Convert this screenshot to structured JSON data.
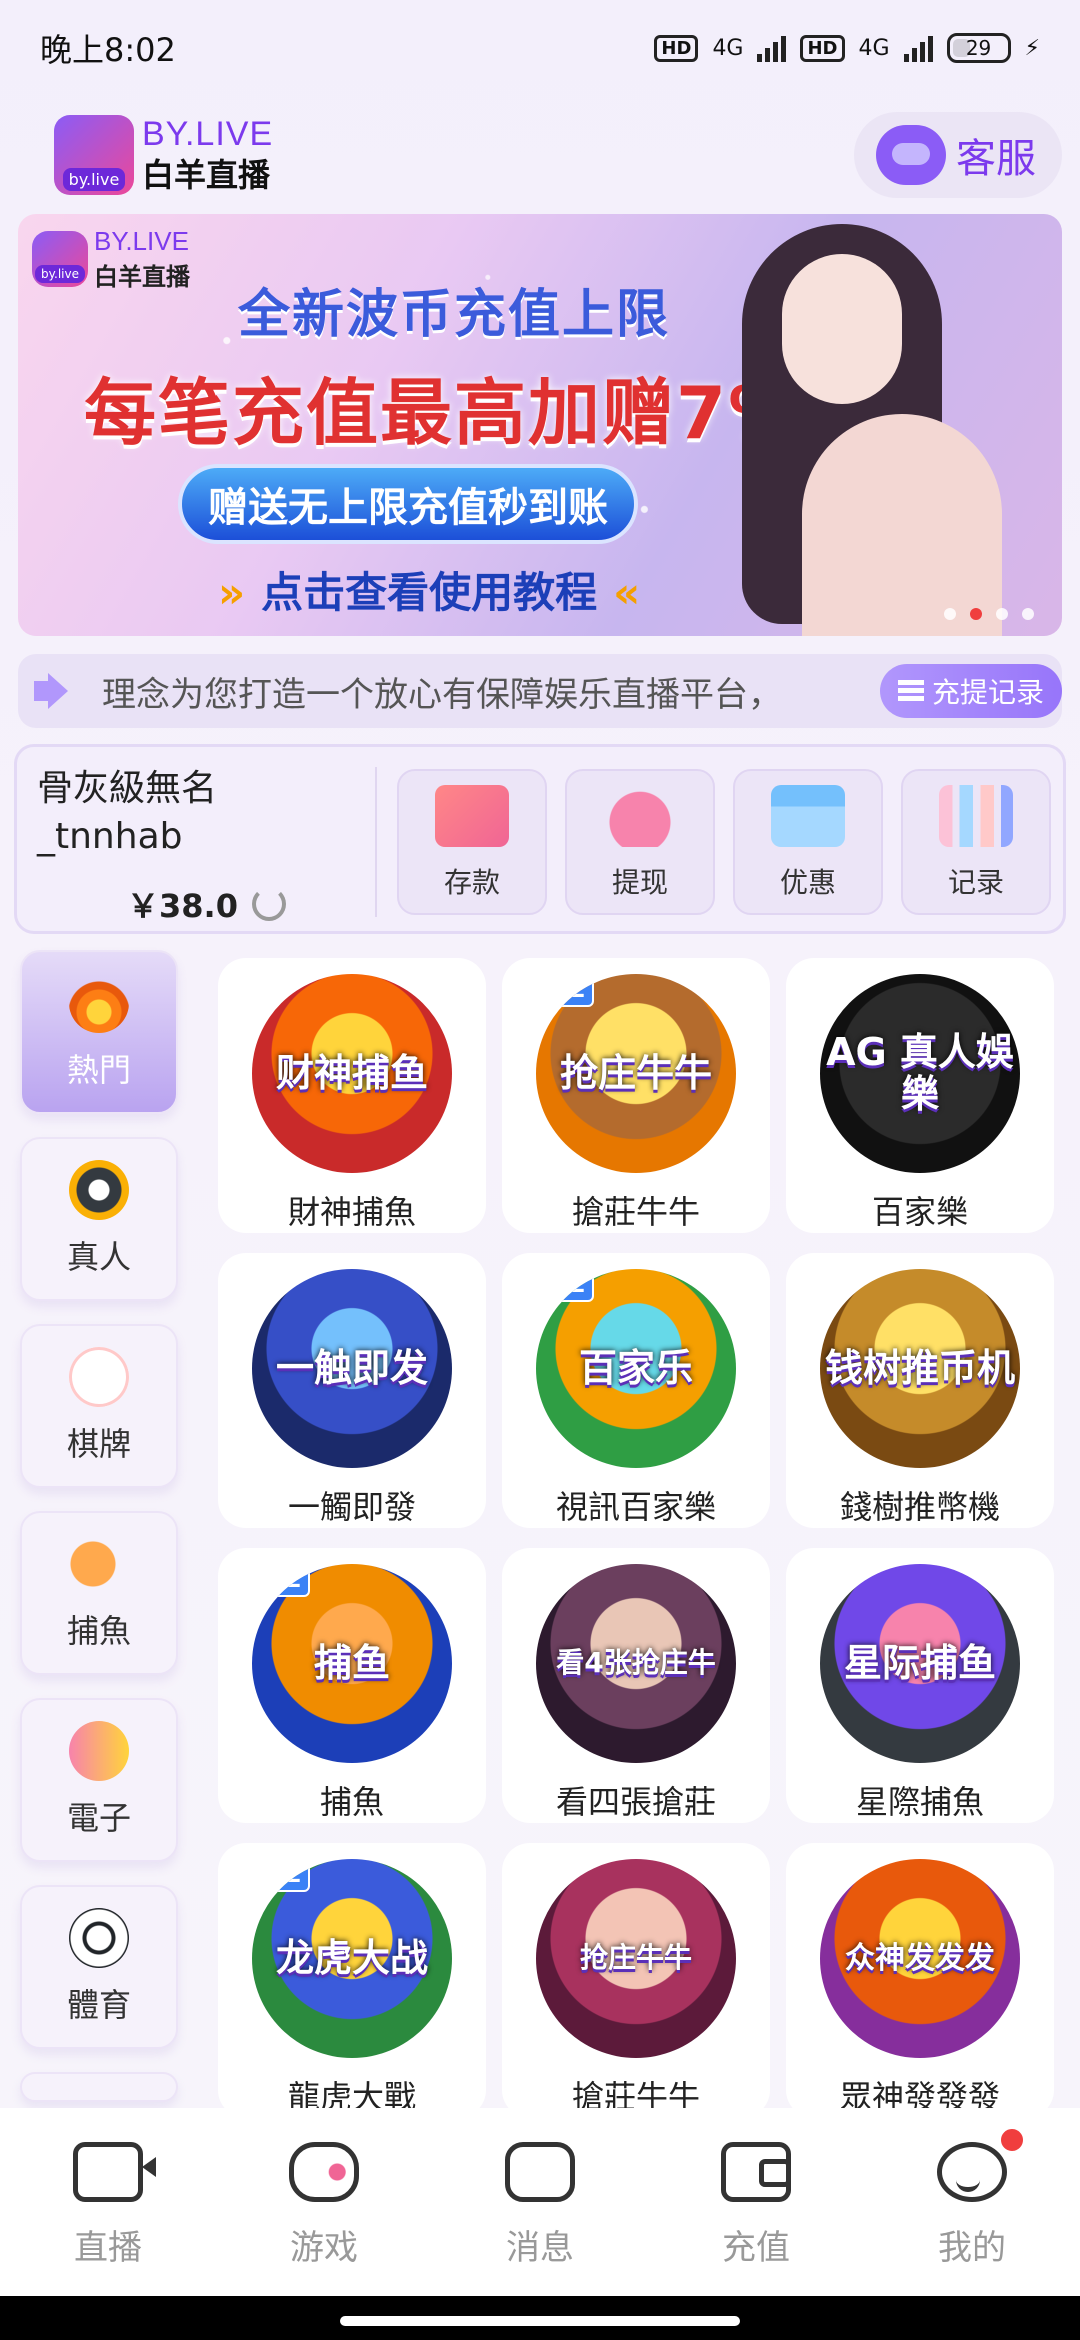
{
  "status": {
    "time": "晚上8:02",
    "net1": "4G",
    "net2": "4G",
    "battery": "29",
    "hd": "HD"
  },
  "header": {
    "logo_en": "BY.LIVE",
    "logo_cn": "白羊直播",
    "logo_badge": "by.live",
    "service_label": "客服"
  },
  "banner": {
    "logo_en": "BY.LIVE",
    "logo_cn": "白羊直播",
    "logo_badge": "by.live",
    "title1": "全新波币充值上限",
    "title2": "每笔充值最高加赠7%",
    "pill": "赠送无上限充值秒到账",
    "sub": "点击查看使用教程",
    "slides": 4,
    "active_slide": 2
  },
  "notice": {
    "text": "理念为您打造一个放心有保障娱乐直播平台，",
    "record_button": "充提记录"
  },
  "account": {
    "username_line1": "骨灰級無名",
    "username_line2": "_tnnhab",
    "balance": "￥38.0",
    "actions": [
      {
        "label": "存款",
        "icon": "card-icon"
      },
      {
        "label": "提现",
        "icon": "money-bag-icon"
      },
      {
        "label": "优惠",
        "icon": "gift-icon"
      },
      {
        "label": "记录",
        "icon": "chart-icon"
      }
    ]
  },
  "categories": [
    {
      "label": "熱門",
      "icon": "fire-icon",
      "active": true
    },
    {
      "label": "真人",
      "icon": "chip-icon"
    },
    {
      "label": "棋牌",
      "icon": "card-icon"
    },
    {
      "label": "捕魚",
      "icon": "fish-icon"
    },
    {
      "label": "電子",
      "icon": "slot-icon"
    },
    {
      "label": "體育",
      "icon": "soccer-icon"
    }
  ],
  "games": [
    {
      "name": "財神捕魚",
      "art": "财神捕鱼",
      "wl": false
    },
    {
      "name": "搶莊牛牛",
      "art": "抢庄牛牛",
      "wl": true
    },
    {
      "name": "百家樂",
      "art": "AG 真人娛樂",
      "wl": false
    },
    {
      "name": "一觸即發",
      "art": "一触即发",
      "wl": false
    },
    {
      "name": "視訊百家樂",
      "art": "百家乐",
      "wl": true
    },
    {
      "name": "錢樹推幣機",
      "art": "钱树推币机",
      "wl": false
    },
    {
      "name": "捕魚",
      "art": "捕鱼",
      "wl": true
    },
    {
      "name": "看四張搶莊",
      "art": "看4张抢庄牛",
      "wl": false
    },
    {
      "name": "星際捕魚",
      "art": "星际捕鱼",
      "wl": false
    },
    {
      "name": "龍虎大戰",
      "art": "龙虎大战",
      "wl": true
    },
    {
      "name": "搶莊牛牛",
      "art": "抢庄牛牛",
      "wl": false
    },
    {
      "name": "眾神發發發",
      "art": "众神发发发",
      "wl": false
    }
  ],
  "wl_label": "WL",
  "bottom_nav": [
    {
      "label": "直播",
      "icon": "video-camera-icon"
    },
    {
      "label": "游戏",
      "icon": "gamepad-icon"
    },
    {
      "label": "消息",
      "icon": "chat-icon"
    },
    {
      "label": "充值",
      "icon": "wallet-icon"
    },
    {
      "label": "我的",
      "icon": "smiley-profile-icon",
      "badge": true
    }
  ]
}
